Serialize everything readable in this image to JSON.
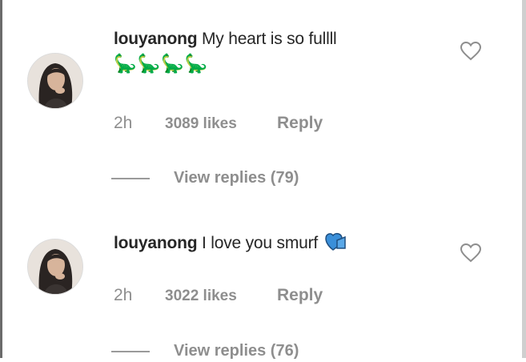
{
  "comments": [
    {
      "username": "louyanong",
      "text": "My heart is so fullll",
      "emoji_line": "🦕🦕🦕🦕",
      "time": "2h",
      "likes": "3089 likes",
      "reply_label": "Reply",
      "view_replies": "View replies (79)",
      "emoji_icon": "dinosaur-icon"
    },
    {
      "username": "louyanong",
      "text": "I love you smurf",
      "time": "2h",
      "likes": "3022 likes",
      "reply_label": "Reply",
      "view_replies": "View replies (76)",
      "emoji_icon": "blue-heart-hand-icon"
    }
  ],
  "colors": {
    "text": "#262626",
    "secondary": "#8e8e8e",
    "accent_blue": "#3a8fd9"
  }
}
